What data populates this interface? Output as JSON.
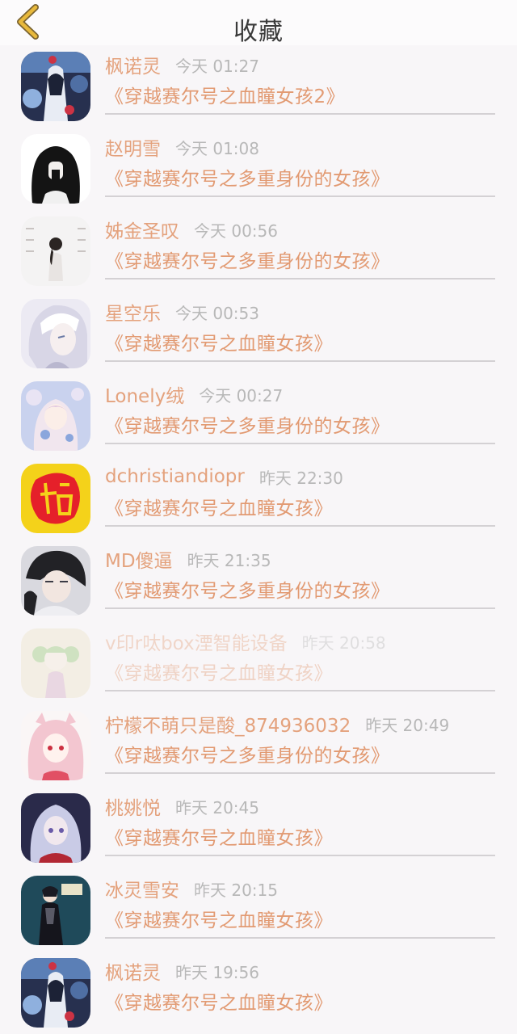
{
  "header": {
    "title": "收藏",
    "back_icon": "chevron-left-icon",
    "accent": "#e2b13b"
  },
  "colors": {
    "name": "#e4a27d",
    "novel": "#e29a72",
    "time": "#b8b8b8",
    "divider": "#d4d1d4"
  },
  "items": [
    {
      "name": "枫诺灵",
      "time": "今天 01:27",
      "novel": "《穿越赛尔号之血瞳女孩2》",
      "avatar": "anime-avatar-blue-dark"
    },
    {
      "name": "赵明雪",
      "time": "今天 01:08",
      "novel": "《穿越赛尔号之多重身份的女孩》",
      "avatar": "black-silhouette-avatar"
    },
    {
      "name": "姊金圣叹",
      "time": "今天 00:56",
      "novel": "《穿越赛尔号之多重身份的女孩》",
      "avatar": "minimal-photo-avatar"
    },
    {
      "name": "星空乐",
      "time": "今天 00:53",
      "novel": "《穿越赛尔号之血瞳女孩》",
      "avatar": "white-hair-anime-avatar"
    },
    {
      "name": "Lonely绒",
      "time": "今天 00:27",
      "novel": "《穿越赛尔号之多重身份的女孩》",
      "avatar": "pastel-anime-avatar"
    },
    {
      "name": "dchristiandiopr",
      "time": "昨天 22:30",
      "novel": "《穿越赛尔号之血瞳女孩》",
      "avatar": "red-fu-character-avatar"
    },
    {
      "name": "MD傻逼",
      "time": "昨天 21:35",
      "novel": "《穿越赛尔号之多重身份的女孩》",
      "avatar": "dark-hair-anime-avatar"
    },
    {
      "name": "v印r呔box湮智能设备",
      "time": "昨天 20:58",
      "novel": "《穿越赛尔号之血瞳女孩》",
      "avatar": "green-hair-anime-avatar",
      "faded": true
    },
    {
      "name": "柠檬不萌只是酸_874936032",
      "time": "昨天 20:49",
      "novel": "《穿越赛尔号之多重身份的女孩》",
      "avatar": "pink-hair-anime-avatar"
    },
    {
      "name": "桃姚悦",
      "time": "昨天 20:45",
      "novel": "《穿越赛尔号之血瞳女孩》",
      "avatar": "silver-hair-anime-avatar"
    },
    {
      "name": "冰灵雪安",
      "time": "昨天 20:15",
      "novel": "《穿越赛尔号之血瞳女孩》",
      "avatar": "gothic-dress-avatar"
    },
    {
      "name": "枫诺灵",
      "time": "昨天 19:56",
      "novel": "《穿越赛尔号之血瞳女孩》",
      "avatar": "anime-avatar-blue-dark"
    }
  ]
}
